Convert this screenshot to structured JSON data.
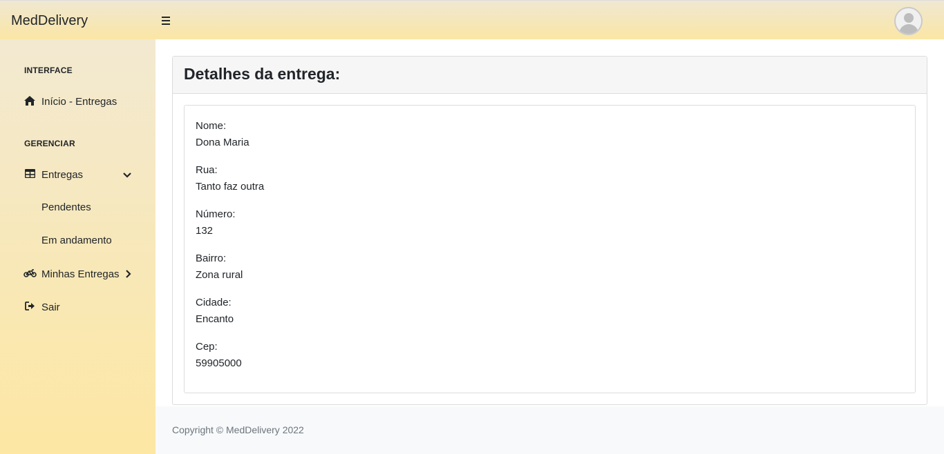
{
  "app": {
    "brand": "MedDelivery"
  },
  "sidebar": {
    "heading_interface": "INTERFACE",
    "item_inicio": "Início - Entregas",
    "heading_gerenciar": "GERENCIAR",
    "item_entregas": "Entregas",
    "sub_pendentes": "Pendentes",
    "sub_andamento": "Em andamento",
    "item_minhas": "Minhas Entregas",
    "item_sair": "Sair",
    "icons": [
      "home-icon",
      "table-icon",
      "chevron-down-icon",
      "motorcycle-icon",
      "chevron-right-icon",
      "sign-out-icon"
    ]
  },
  "main": {
    "title": "Detalhes da entrega:",
    "fields": [
      {
        "label": "Nome:",
        "value": "Dona Maria"
      },
      {
        "label": "Rua:",
        "value": "Tanto faz outra"
      },
      {
        "label": "Número:",
        "value": "132"
      },
      {
        "label": "Bairro:",
        "value": "Zona rural"
      },
      {
        "label": "Cidade:",
        "value": "Encanto"
      },
      {
        "label": "Cep:",
        "value": "59905000"
      }
    ]
  },
  "footer": {
    "text": "Copyright © MedDelivery 2022"
  },
  "colors": {
    "topbar_gradient_start": "#efe8d2",
    "topbar_gradient_end": "#fbe6a4",
    "sidebar_gradient_start": "#f2e9d1",
    "sidebar_gradient_end": "#fde7a3",
    "card_header_bg": "#f6f6f6",
    "footer_bg": "#f8f9fa",
    "footer_text": "#6c757d"
  }
}
